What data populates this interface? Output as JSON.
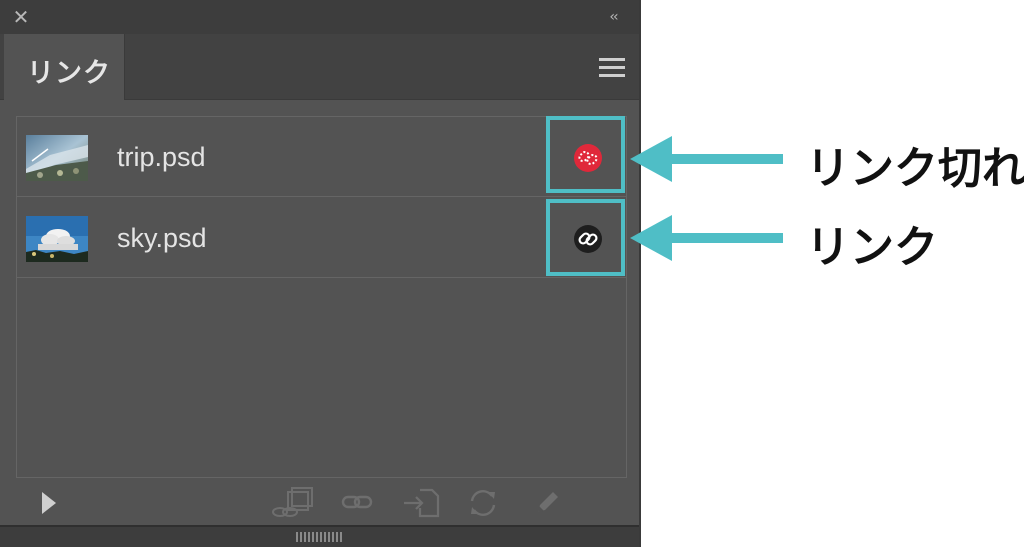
{
  "panel": {
    "close_glyph": "✕",
    "collapse_glyph": "‹‹",
    "tab_label": "リンク",
    "menu_icon": "hamburger-menu-icon"
  },
  "links": [
    {
      "filename": "trip.psd",
      "status": "missing",
      "thumbnail": "photo-thumbnail",
      "status_icon": "broken-link-icon",
      "status_color": "#e0283a"
    },
    {
      "filename": "sky.psd",
      "status": "linked",
      "thumbnail": "sky-photo-thumbnail",
      "status_icon": "link-icon",
      "status_color": "#1e1e1e"
    }
  ],
  "toolbar": {
    "buttons": [
      "play-icon",
      "relink-from-cc-icon",
      "relink-icon",
      "go-to-link-icon",
      "update-link-icon",
      "edit-original-icon"
    ]
  },
  "annotations": {
    "broken_label": "リンク切れ",
    "link_label": "リンク",
    "accent": "#4fbec6"
  }
}
